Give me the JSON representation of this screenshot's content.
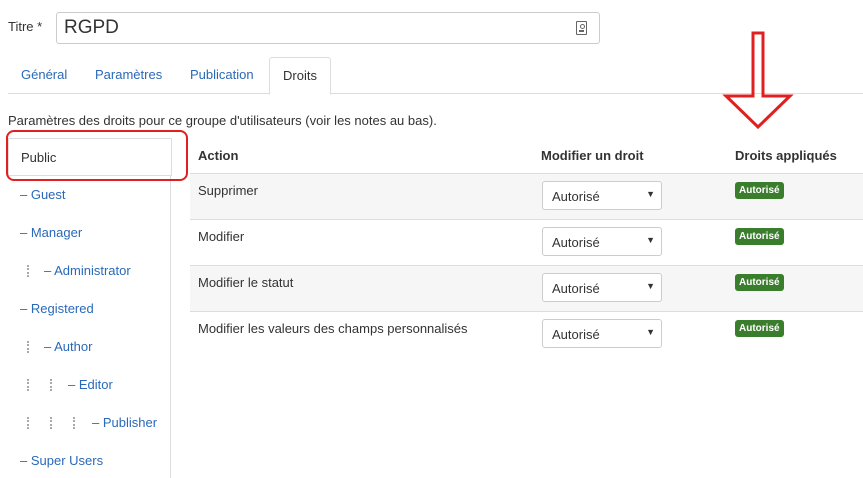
{
  "title": {
    "label": "Titre *",
    "value": "RGPD"
  },
  "tabs": [
    {
      "label": "Général"
    },
    {
      "label": "Paramètres"
    },
    {
      "label": "Publication"
    },
    {
      "label": "Droits"
    }
  ],
  "description": "Paramètres des droits pour ce groupe d'utilisateurs (voir les notes au bas).",
  "groups": [
    {
      "label": "Public"
    },
    {
      "label": "– Guest"
    },
    {
      "label": "– Manager"
    },
    {
      "label": "– Administrator"
    },
    {
      "label": "– Registered"
    },
    {
      "label": "– Author"
    },
    {
      "label": "– Editor"
    },
    {
      "label": "– Publisher"
    },
    {
      "label": "– Super Users"
    }
  ],
  "table": {
    "headers": {
      "action": "Action",
      "modify": "Modifier un droit",
      "applied": "Droits appliqués"
    },
    "rows": [
      {
        "action": "Supprimer",
        "select": "Autorisé",
        "badge": "Autorisé"
      },
      {
        "action": "Modifier",
        "select": "Autorisé",
        "badge": "Autorisé"
      },
      {
        "action": "Modifier le statut",
        "select": "Autorisé",
        "badge": "Autorisé"
      },
      {
        "action": "Modifier les valeurs des champs personnalisés",
        "select": "Autorisé",
        "badge": "Autorisé"
      }
    ]
  },
  "colors": {
    "link": "#2a69b8",
    "badge": "#3a7d2c",
    "annotation": "#e02020"
  },
  "icons": {
    "title_field": "contact-card-icon",
    "select_caret": "caret-down-icon",
    "annotation_arrow": "down-arrow-icon"
  }
}
